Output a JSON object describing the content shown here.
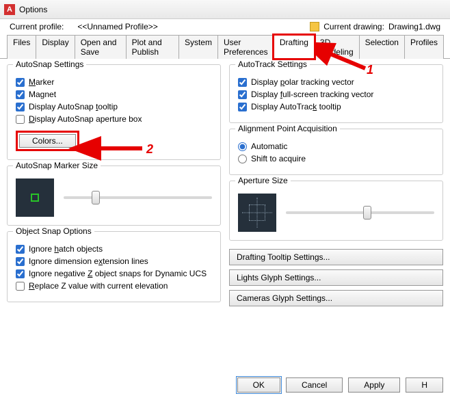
{
  "window": {
    "title": "Options",
    "app_abbrev": "A"
  },
  "profile_row": {
    "label": "Current profile:",
    "value": "<<Unnamed Profile>>",
    "drawing_label": "Current drawing:",
    "drawing_value": "Drawing1.dwg"
  },
  "tabs": [
    "Files",
    "Display",
    "Open and Save",
    "Plot and Publish",
    "System",
    "User Preferences",
    "Drafting",
    "3D Modeling",
    "Selection",
    "Profiles"
  ],
  "active_tab": "Drafting",
  "autosnap": {
    "legend": "AutoSnap Settings",
    "marker": "Marker",
    "magnet": "Magnet",
    "tooltip": "Display AutoSnap tooltip",
    "aperture": "Display AutoSnap aperture box",
    "colors_btn": "Colors..."
  },
  "autotrack": {
    "legend": "AutoTrack Settings",
    "polar": "Display polar tracking vector",
    "fullscreen": "Display full-screen tracking vector",
    "tooltip": "Display AutoTrack tooltip"
  },
  "alignment": {
    "legend": "Alignment Point Acquisition",
    "auto": "Automatic",
    "shift": "Shift to acquire"
  },
  "marker_size": {
    "legend": "AutoSnap Marker Size"
  },
  "aperture_size": {
    "legend": "Aperture Size"
  },
  "osnap": {
    "legend": "Object Snap Options",
    "hatch": "Ignore hatch objects",
    "dim": "Ignore dimension extension lines",
    "negz": "Ignore negative Z object snaps for Dynamic UCS",
    "replacez": "Replace Z value with current elevation"
  },
  "wide_buttons": {
    "tooltip": "Drafting Tooltip Settings...",
    "lights": "Lights Glyph Settings...",
    "cameras": "Cameras Glyph Settings..."
  },
  "footer": {
    "ok": "OK",
    "cancel": "Cancel",
    "apply": "Apply",
    "help": "H"
  },
  "annotations": {
    "num1": "1",
    "num2": "2"
  }
}
